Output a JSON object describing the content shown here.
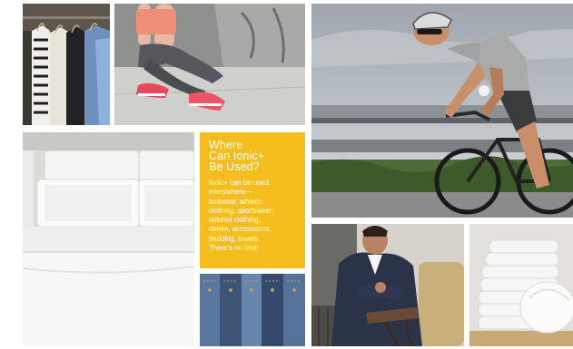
{
  "info_panel": {
    "title": "Where\nCan Ionic+\nBe Used?",
    "body": "Ionic+ can be used\neverywhere—\nfootwear, athletic\nclothing, sportswear,\ntailored clothing,\ndenim, accessories,\nbedding, towels.\nThere's no limit!"
  },
  "colors": {
    "panel_background": "#f6bd1f",
    "panel_text": "#ffffff",
    "page_background": "#ffffff"
  }
}
